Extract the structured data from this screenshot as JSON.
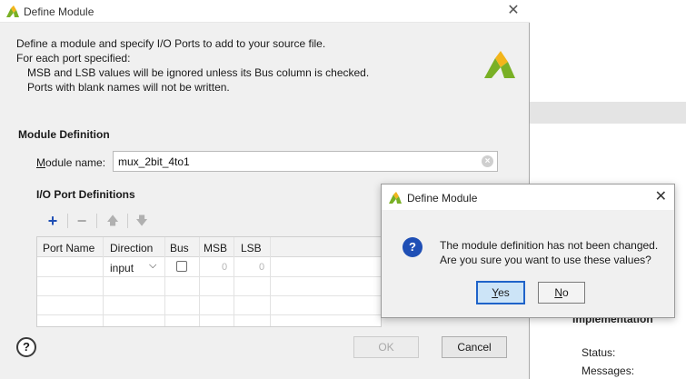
{
  "background_app": {
    "section_label": "Implementation",
    "status_label": "Status:",
    "messages_label": "Messages:"
  },
  "main_dialog": {
    "title": "Define Module",
    "description": [
      "Define a module and specify I/O Ports to add to your source file.",
      "For each port specified:",
      "MSB and LSB values will be ignored unless its Bus column is checked.",
      "Ports with blank names will not be written."
    ],
    "module_definition_heading": "Module Definition",
    "module_name_label_first": "M",
    "module_name_label_rest": "odule name:",
    "module_name_value": "mux_2bit_4to1",
    "io_port_heading": "I/O Port Definitions",
    "toolbar": {
      "add_icon": "+",
      "remove_icon": "−",
      "move_up_icon": "🡅",
      "move_down_icon": "🡇"
    },
    "port_table": {
      "columns": [
        "Port Name",
        "Direction",
        "Bus",
        "MSB",
        "LSB"
      ],
      "rows": [
        {
          "port_name": "",
          "direction": "input",
          "bus": false,
          "msb": "0",
          "lsb": "0"
        }
      ]
    },
    "help_icon": "?",
    "ok_label": "OK",
    "cancel_label": "Cancel"
  },
  "confirm_dialog": {
    "title": "Define Module",
    "question_icon": "?",
    "message_lines": [
      "The module definition has not been changed.",
      "Are you sure you want to use these values?"
    ],
    "yes_label_first": "Y",
    "yes_label_rest": "es",
    "no_label_first": "N",
    "no_label_rest": "o"
  },
  "colors": {
    "brand_green": "#79b025",
    "brand_yellow": "#f2b51b",
    "accent_blue": "#1f63c9"
  }
}
